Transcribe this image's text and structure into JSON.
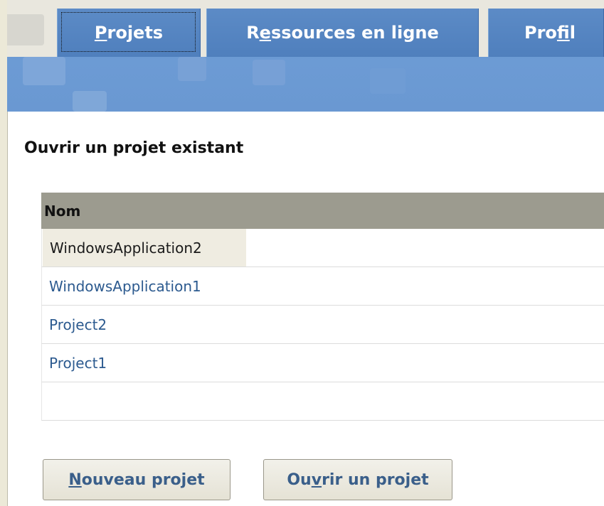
{
  "tabs": [
    {
      "label_pre": "",
      "label_u": "P",
      "label_post": "rojets"
    },
    {
      "label_pre": "R",
      "label_u": "e",
      "label_post": "ssources en ligne"
    },
    {
      "label_pre": "Pro",
      "label_u": "f",
      "label_post": "il"
    }
  ],
  "section": {
    "title": "Ouvrir un projet existant"
  },
  "table": {
    "header": "Nom",
    "rows": [
      "WindowsApplication2",
      "WindowsApplication1",
      "Project2",
      "Project1"
    ]
  },
  "buttons": {
    "new_pre": "",
    "new_u": "N",
    "new_post": "ouveau projet",
    "open_pre": "Ou",
    "open_u": "v",
    "open_post": "rir un projet"
  },
  "colors": {
    "banner": "#6a98d2",
    "tab": "#5c8bc6",
    "header": "#9c9b8f",
    "link": "#2c5a8f",
    "button_text": "#3a5f8a"
  }
}
